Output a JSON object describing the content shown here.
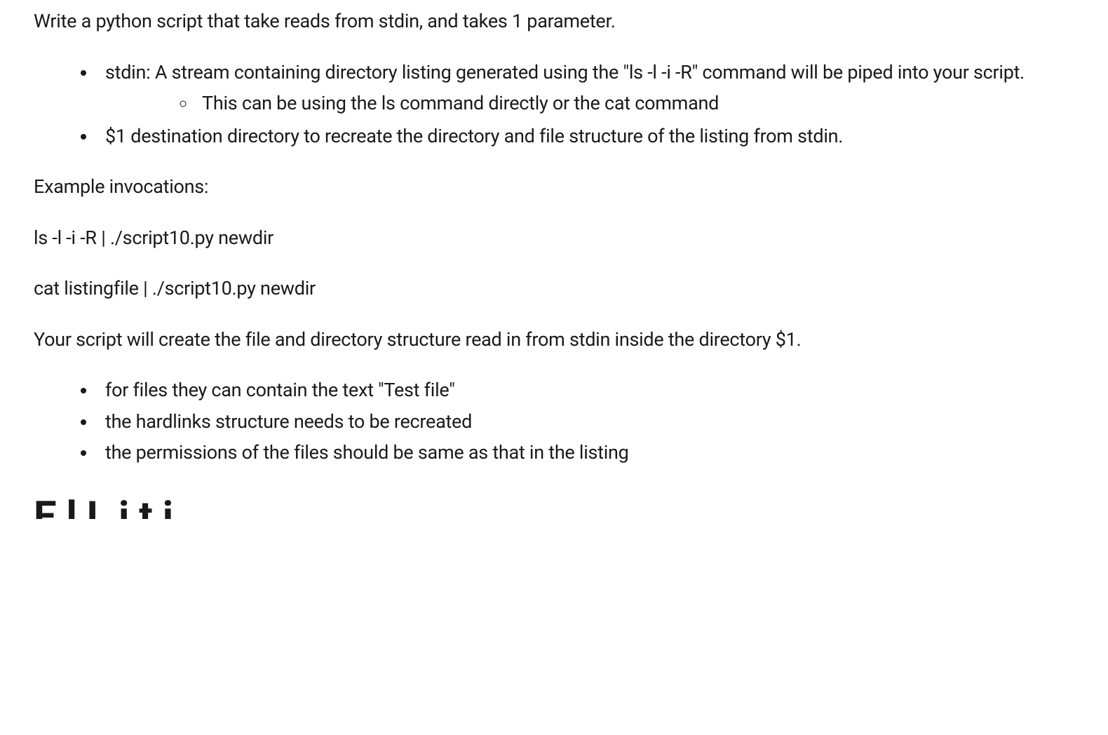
{
  "intro": "Write a python script that take reads from stdin, and takes 1 parameter.",
  "bullets1": {
    "item0": "stdin: A stream containing directory listing generated using the \"ls -l -i -R\" command will be piped into your script.",
    "item0_sub": "This can be using the ls command directly or the cat command",
    "item1": "$1 destination directory to recreate the directory and file structure of the listing from stdin."
  },
  "example_heading": "Example invocations:",
  "example1": "ls -l -i -R | ./script10.py newdir",
  "example2": "cat listingfile | ./script10.py newdir",
  "description": "Your script will create the file and directory structure read in from stdin inside the directory $1.",
  "bullets2": {
    "item0": "for files they can contain the text \"Test file\"",
    "item1": "the hardlinks structure needs to be recreated",
    "item2": "the permissions of the files should be same as that in the listing"
  },
  "heading_fragment": "E            l   L i    t i"
}
